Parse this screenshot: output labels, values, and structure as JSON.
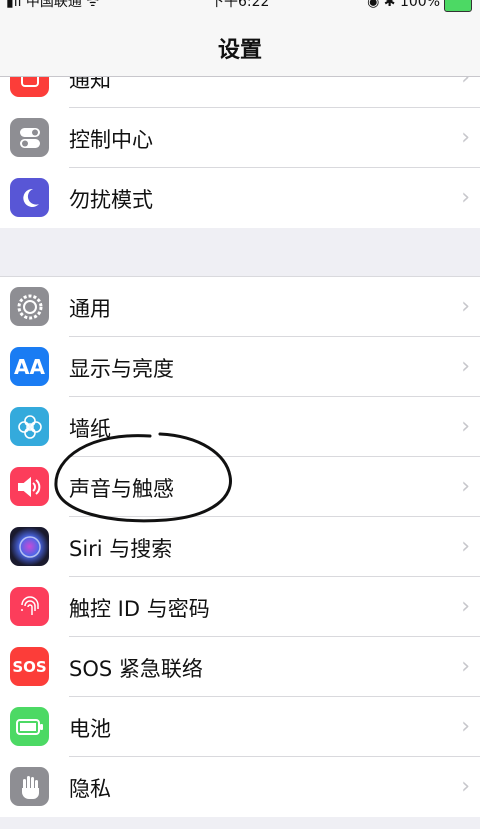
{
  "status_bar": {
    "carrier": "▮ıl 中国联通 ᯤ",
    "time": "下午6:22",
    "right": "◉ ✱ 100%"
  },
  "header": {
    "title": "设置"
  },
  "groups": [
    {
      "items": [
        {
          "label": "通知",
          "icon": "notifications-icon",
          "color": "#fc3d39"
        },
        {
          "label": "控制中心",
          "icon": "control-center-icon",
          "color": "#8e8e93"
        },
        {
          "label": "勿扰模式",
          "icon": "moon-icon",
          "color": "#5856d6"
        }
      ]
    },
    {
      "items": [
        {
          "label": "通用",
          "icon": "gear-icon",
          "color": "#8e8e93"
        },
        {
          "label": "显示与亮度",
          "icon": "display-brightness-icon",
          "color": "#1a7cf3",
          "glyph": "AA"
        },
        {
          "label": "墙纸",
          "icon": "wallpaper-icon",
          "color": "#34aadc"
        },
        {
          "label": "声音与触感",
          "icon": "speaker-icon",
          "color": "#fc3d5b"
        },
        {
          "label": "Siri 与搜索",
          "icon": "siri-icon",
          "color": "#222"
        },
        {
          "label": "触控 ID 与密码",
          "icon": "fingerprint-icon",
          "color": "#fc3d5b"
        },
        {
          "label": "SOS 紧急联络",
          "icon": "sos-icon",
          "color": "#fc3d39",
          "glyph": "SOS"
        },
        {
          "label": "电池",
          "icon": "battery-icon",
          "color": "#4cd964"
        },
        {
          "label": "隐私",
          "icon": "hand-icon",
          "color": "#8e8e93"
        }
      ]
    }
  ],
  "chevron": "›"
}
